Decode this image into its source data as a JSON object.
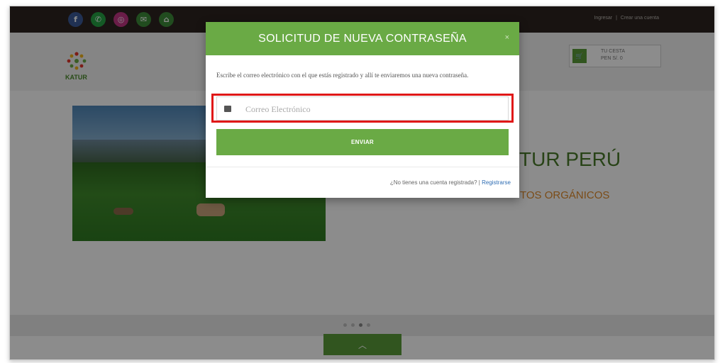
{
  "topbar": {
    "social_icons": [
      "facebook-icon",
      "whatsapp-icon",
      "instagram-icon",
      "mail-icon",
      "home-icon"
    ],
    "link_login": "Ingresar",
    "separator": "|",
    "link_register": "Crear una cuenta"
  },
  "header": {
    "logo_text": "KATUR",
    "cart_line1": "TU CESTA",
    "cart_line2": "PEN S/. 0"
  },
  "hero": {
    "title": "TUR PERÚ",
    "subtitle": "TOS ORGÁNICOS"
  },
  "modal": {
    "title": "SOLICITUD DE NUEVA CONTRASEÑA",
    "close_label": "×",
    "description": "Escribe el correo electrónico con el que estás registrado y allí te enviaremos una nueva contraseña.",
    "email_placeholder": "Correo Electrónico",
    "email_value": "",
    "submit_label": "ENVIAR",
    "footer_question": "¿No tienes una cuenta registrada? |",
    "footer_link": "Registrarse"
  },
  "colors": {
    "brand_green": "#6aaa45",
    "topbar": "#2c2420",
    "highlight": "#e01818",
    "accent_orange": "#e08a2a"
  }
}
